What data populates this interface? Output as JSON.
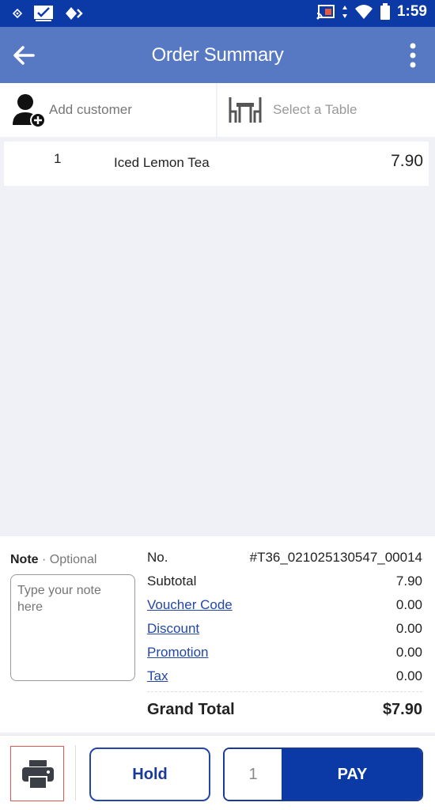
{
  "status_bar": {
    "time": "1:59"
  },
  "app_bar": {
    "title": "Order Summary"
  },
  "customer": {
    "label": "Add customer"
  },
  "table": {
    "label": "Select a Table"
  },
  "items": [
    {
      "qty": "1",
      "name": "Iced Lemon Tea",
      "price": "7.90"
    }
  ],
  "note": {
    "label": "Note",
    "optional": "Optional",
    "separator": "·",
    "placeholder": "Type your note here"
  },
  "summary": {
    "no_label": "No.",
    "no_value": "#T36_021025130547_00014",
    "subtotal_label": "Subtotal",
    "subtotal_value": "7.90",
    "voucher_label": "Voucher Code",
    "voucher_value": "0.00",
    "discount_label": "Discount",
    "discount_value": "0.00",
    "promotion_label": "Promotion",
    "promotion_value": "0.00",
    "tax_label": "Tax",
    "tax_value": "0.00",
    "grand_label": "Grand Total",
    "grand_value": "$7.90"
  },
  "actions": {
    "hold_label": "Hold",
    "pay_qty": "1",
    "pay_label": "PAY"
  },
  "colors": {
    "status_bar": "#0b3aa6",
    "app_bar": "#5779c4",
    "accent": "#1a3a99",
    "link": "#2346a8"
  },
  "icons": [
    "nav-icon",
    "image-check-icon",
    "diamond-icon",
    "cast-icon",
    "data-arrows-icon",
    "wifi-icon",
    "battery-icon",
    "back-arrow-icon",
    "more-vert-icon",
    "add-person-icon",
    "table-icon",
    "printer-icon"
  ]
}
